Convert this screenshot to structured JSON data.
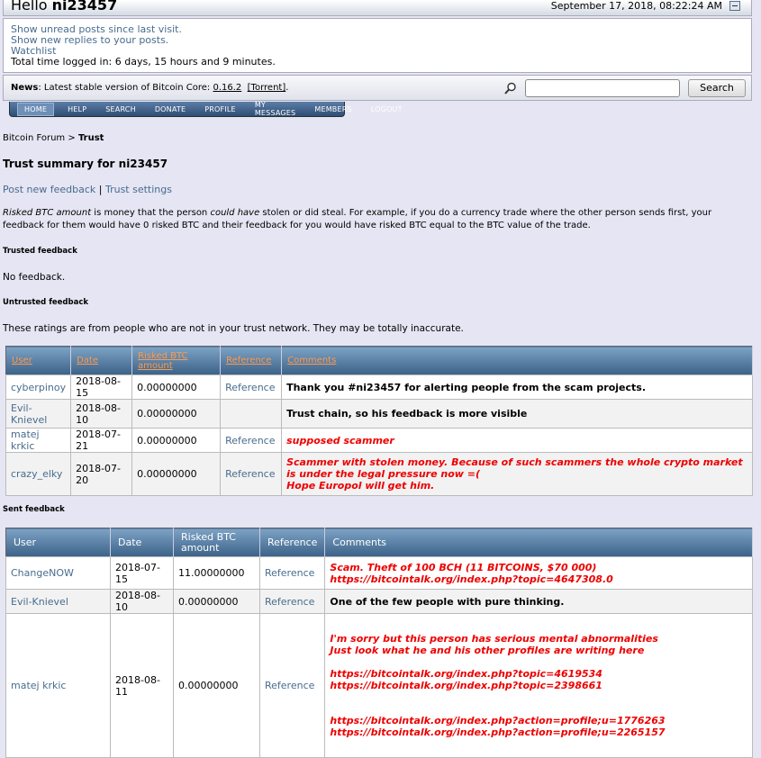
{
  "header": {
    "greeting": "Hello",
    "username": "ni23457",
    "datetime": "September 17, 2018, 08:22:24 AM"
  },
  "user_links": {
    "unread": "Show unread posts since last visit.",
    "replies": "Show new replies to your posts.",
    "watchlist": "Watchlist",
    "time_logged": "Total time logged in: 6 days, 15 hours and 9 minutes."
  },
  "news": {
    "label": "News",
    "text": ": Latest stable version of Bitcoin Core: ",
    "version": "0.16.2",
    "torrent": "[Torrent]",
    "end": "."
  },
  "search": {
    "button": "Search",
    "placeholder": ""
  },
  "nav": [
    "HOME",
    "HELP",
    "SEARCH",
    "DONATE",
    "PROFILE",
    "MY MESSAGES",
    "MEMBERS",
    "LOGOUT"
  ],
  "breadcrumb": {
    "forum": "Bitcoin Forum",
    "sep": " > ",
    "current": "Trust"
  },
  "page_title": "Trust summary for ni23457",
  "links": {
    "post": "Post new feedback",
    "sep": " | ",
    "settings": "Trust settings"
  },
  "description": {
    "term": "Risked BTC amount",
    "part1": " is money that the person ",
    "em": "could have",
    "part2": " stolen or did steal. For example, if you do a currency trade where the other person sends first, your feedback for them would have 0 risked BTC and their feedback for you would have risked BTC equal to the BTC value of the trade."
  },
  "trusted": {
    "heading": "Trusted feedback",
    "empty": "No feedback."
  },
  "untrusted": {
    "heading": "Untrusted feedback",
    "note": "These ratings are from people who are not in your trust network. They may be totally inaccurate.",
    "columns": [
      "User",
      "Date",
      "Risked BTC amount",
      "Reference",
      "Comments"
    ],
    "rows": [
      {
        "user": "cyberpinoy",
        "date": "2018-08-15",
        "risked": "0.00000000",
        "reference": "Reference",
        "comment": "Thank you #ni23457 for alerting people from the scam projects.",
        "style": "blk"
      },
      {
        "user": "Evil-Knievel",
        "date": "2018-08-10",
        "risked": "0.00000000",
        "reference": "",
        "comment": "Trust chain, so his feedback is more visible",
        "style": "blk"
      },
      {
        "user": "matej krkic",
        "date": "2018-07-21",
        "risked": "0.00000000",
        "reference": "Reference",
        "comment": "supposed scammer",
        "style": "red"
      },
      {
        "user": "crazy_elky",
        "date": "2018-07-20",
        "risked": "0.00000000",
        "reference": "Reference",
        "comment": "Scammer with stolen money. Because of such scammers the whole crypto market is under the legal pressure now =(\nHope Europol will get him.",
        "style": "red"
      }
    ]
  },
  "sent": {
    "heading": "Sent feedback",
    "columns": [
      "User",
      "Date",
      "Risked BTC amount",
      "Reference",
      "Comments"
    ],
    "rows": [
      {
        "user": "ChangeNOW",
        "date": "2018-07-15",
        "risked": "11.00000000",
        "reference": "Reference",
        "comment": "Scam. Theft of 100 BCH (11 BITCOINS, $70 000)\nhttps://bitcointalk.org/index.php?topic=4647308.0",
        "style": "red"
      },
      {
        "user": "Evil-Knievel",
        "date": "2018-08-10",
        "risked": "0.00000000",
        "reference": "Reference",
        "comment": "One of the few people with pure thinking.",
        "style": "blk"
      },
      {
        "user": "matej krkic",
        "date": "2018-08-11",
        "risked": "0.00000000",
        "reference": "Reference",
        "comment": "I'm sorry but this person has serious mental abnormalities\nJust look what he and his other profiles are writing here\n\nhttps://bitcointalk.org/index.php?topic=4619534\nhttps://bitcointalk.org/index.php?topic=2398661\n\n\nhttps://bitcointalk.org/index.php?action=profile;u=1776263\nhttps://bitcointalk.org/index.php?action=profile;u=2265157",
        "style": "red"
      }
    ]
  }
}
